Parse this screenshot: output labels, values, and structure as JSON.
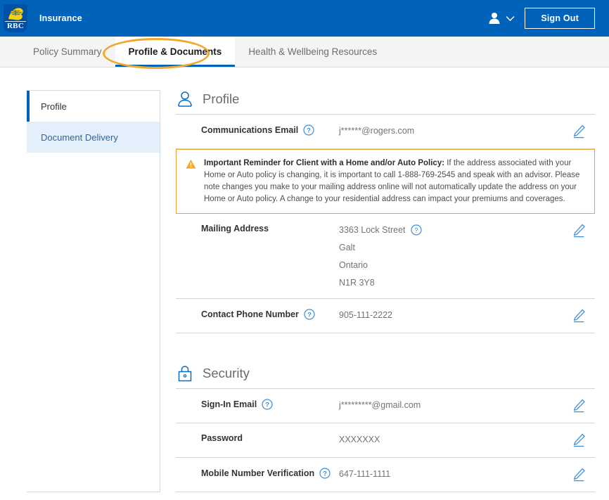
{
  "header": {
    "brand_name": "RBC",
    "title": "Insurance",
    "signout_label": "Sign Out",
    "user_icon": "person-icon",
    "chevron_icon": "chevron-down-icon",
    "background_color": "#0062b9"
  },
  "tabs": [
    {
      "label": "Policy Summary",
      "active": false
    },
    {
      "label": "Profile & Documents",
      "active": true
    },
    {
      "label": "Health & Wellbeing Resources",
      "active": false
    }
  ],
  "annotation": {
    "shape": "ellipse",
    "color": "#f0a92b",
    "targets": "Profile & Documents"
  },
  "sidebar": {
    "items": [
      {
        "label": "Profile",
        "active": true
      },
      {
        "label": "Document Delivery",
        "active": false
      }
    ]
  },
  "profile_section": {
    "icon": "person-outline-icon",
    "title": "Profile",
    "rows": [
      {
        "label": "Communications Email",
        "has_help": true,
        "value": "j******@rogers.com",
        "edit_icon": "pencil-icon"
      },
      {
        "label": "Mailing Address",
        "has_help": false,
        "value_lines": [
          "3363  Lock Street",
          "Galt",
          "Ontario",
          "N1R 3Y8"
        ],
        "first_line_has_help": true,
        "edit_icon": "pencil-icon"
      },
      {
        "label": "Contact Phone Number",
        "has_help": true,
        "value": "905-111-2222",
        "edit_icon": "pencil-icon"
      }
    ]
  },
  "alert": {
    "icon": "warning-triangle-icon",
    "border_color": "#e8a33d",
    "bold_lead": "Important Reminder for Client with a Home and/or Auto Policy:",
    "body": " If the address associated with your Home or Auto policy is changing, it is important to call 1-888-769-2545 and speak with an advisor. Please note changes you make to your mailing address online will not automatically update the address on your Home or Auto policy. A change to your residential address can impact your premiums and coverages."
  },
  "security_section": {
    "icon": "lock-icon",
    "title": "Security",
    "rows": [
      {
        "label": "Sign-In Email",
        "has_help": true,
        "value": "j*********@gmail.com",
        "edit_icon": "pencil-icon"
      },
      {
        "label": "Password",
        "has_help": false,
        "value": "XXXXXXX",
        "edit_icon": "pencil-icon"
      },
      {
        "label": "Mobile Number Verification",
        "has_help": true,
        "value": "647-111-1111",
        "edit_icon": "pencil-icon"
      }
    ]
  }
}
